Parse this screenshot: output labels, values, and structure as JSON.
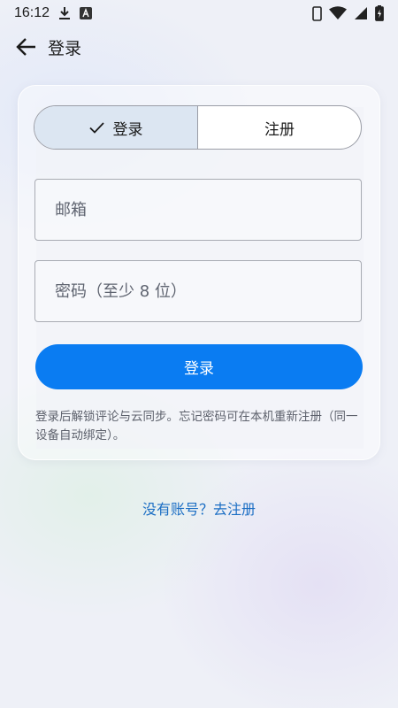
{
  "status_bar": {
    "time": "16:12",
    "icons_left": [
      "download-icon",
      "a-badge-icon"
    ],
    "icons_right": [
      "phone-icon",
      "wifi-icon",
      "signal-icon",
      "battery-charging-icon"
    ]
  },
  "app_bar": {
    "title": "登录",
    "back_icon": "arrow-left-icon"
  },
  "tabs": {
    "login": "登录",
    "register": "注册",
    "selected": "login"
  },
  "form": {
    "email_placeholder": "邮箱",
    "email_value": "",
    "password_placeholder": "密码（至少 8 位）",
    "password_value": "",
    "submit_label": "登录"
  },
  "hint": "登录后解锁评论与云同步。忘记密码可在本机重新注册（同一设备自动绑定）。",
  "register_link": "没有账号？去注册",
  "colors": {
    "primary": "#0a7cf2",
    "link": "#1b6ec4",
    "selected_tab_bg": "#dce6f2"
  }
}
